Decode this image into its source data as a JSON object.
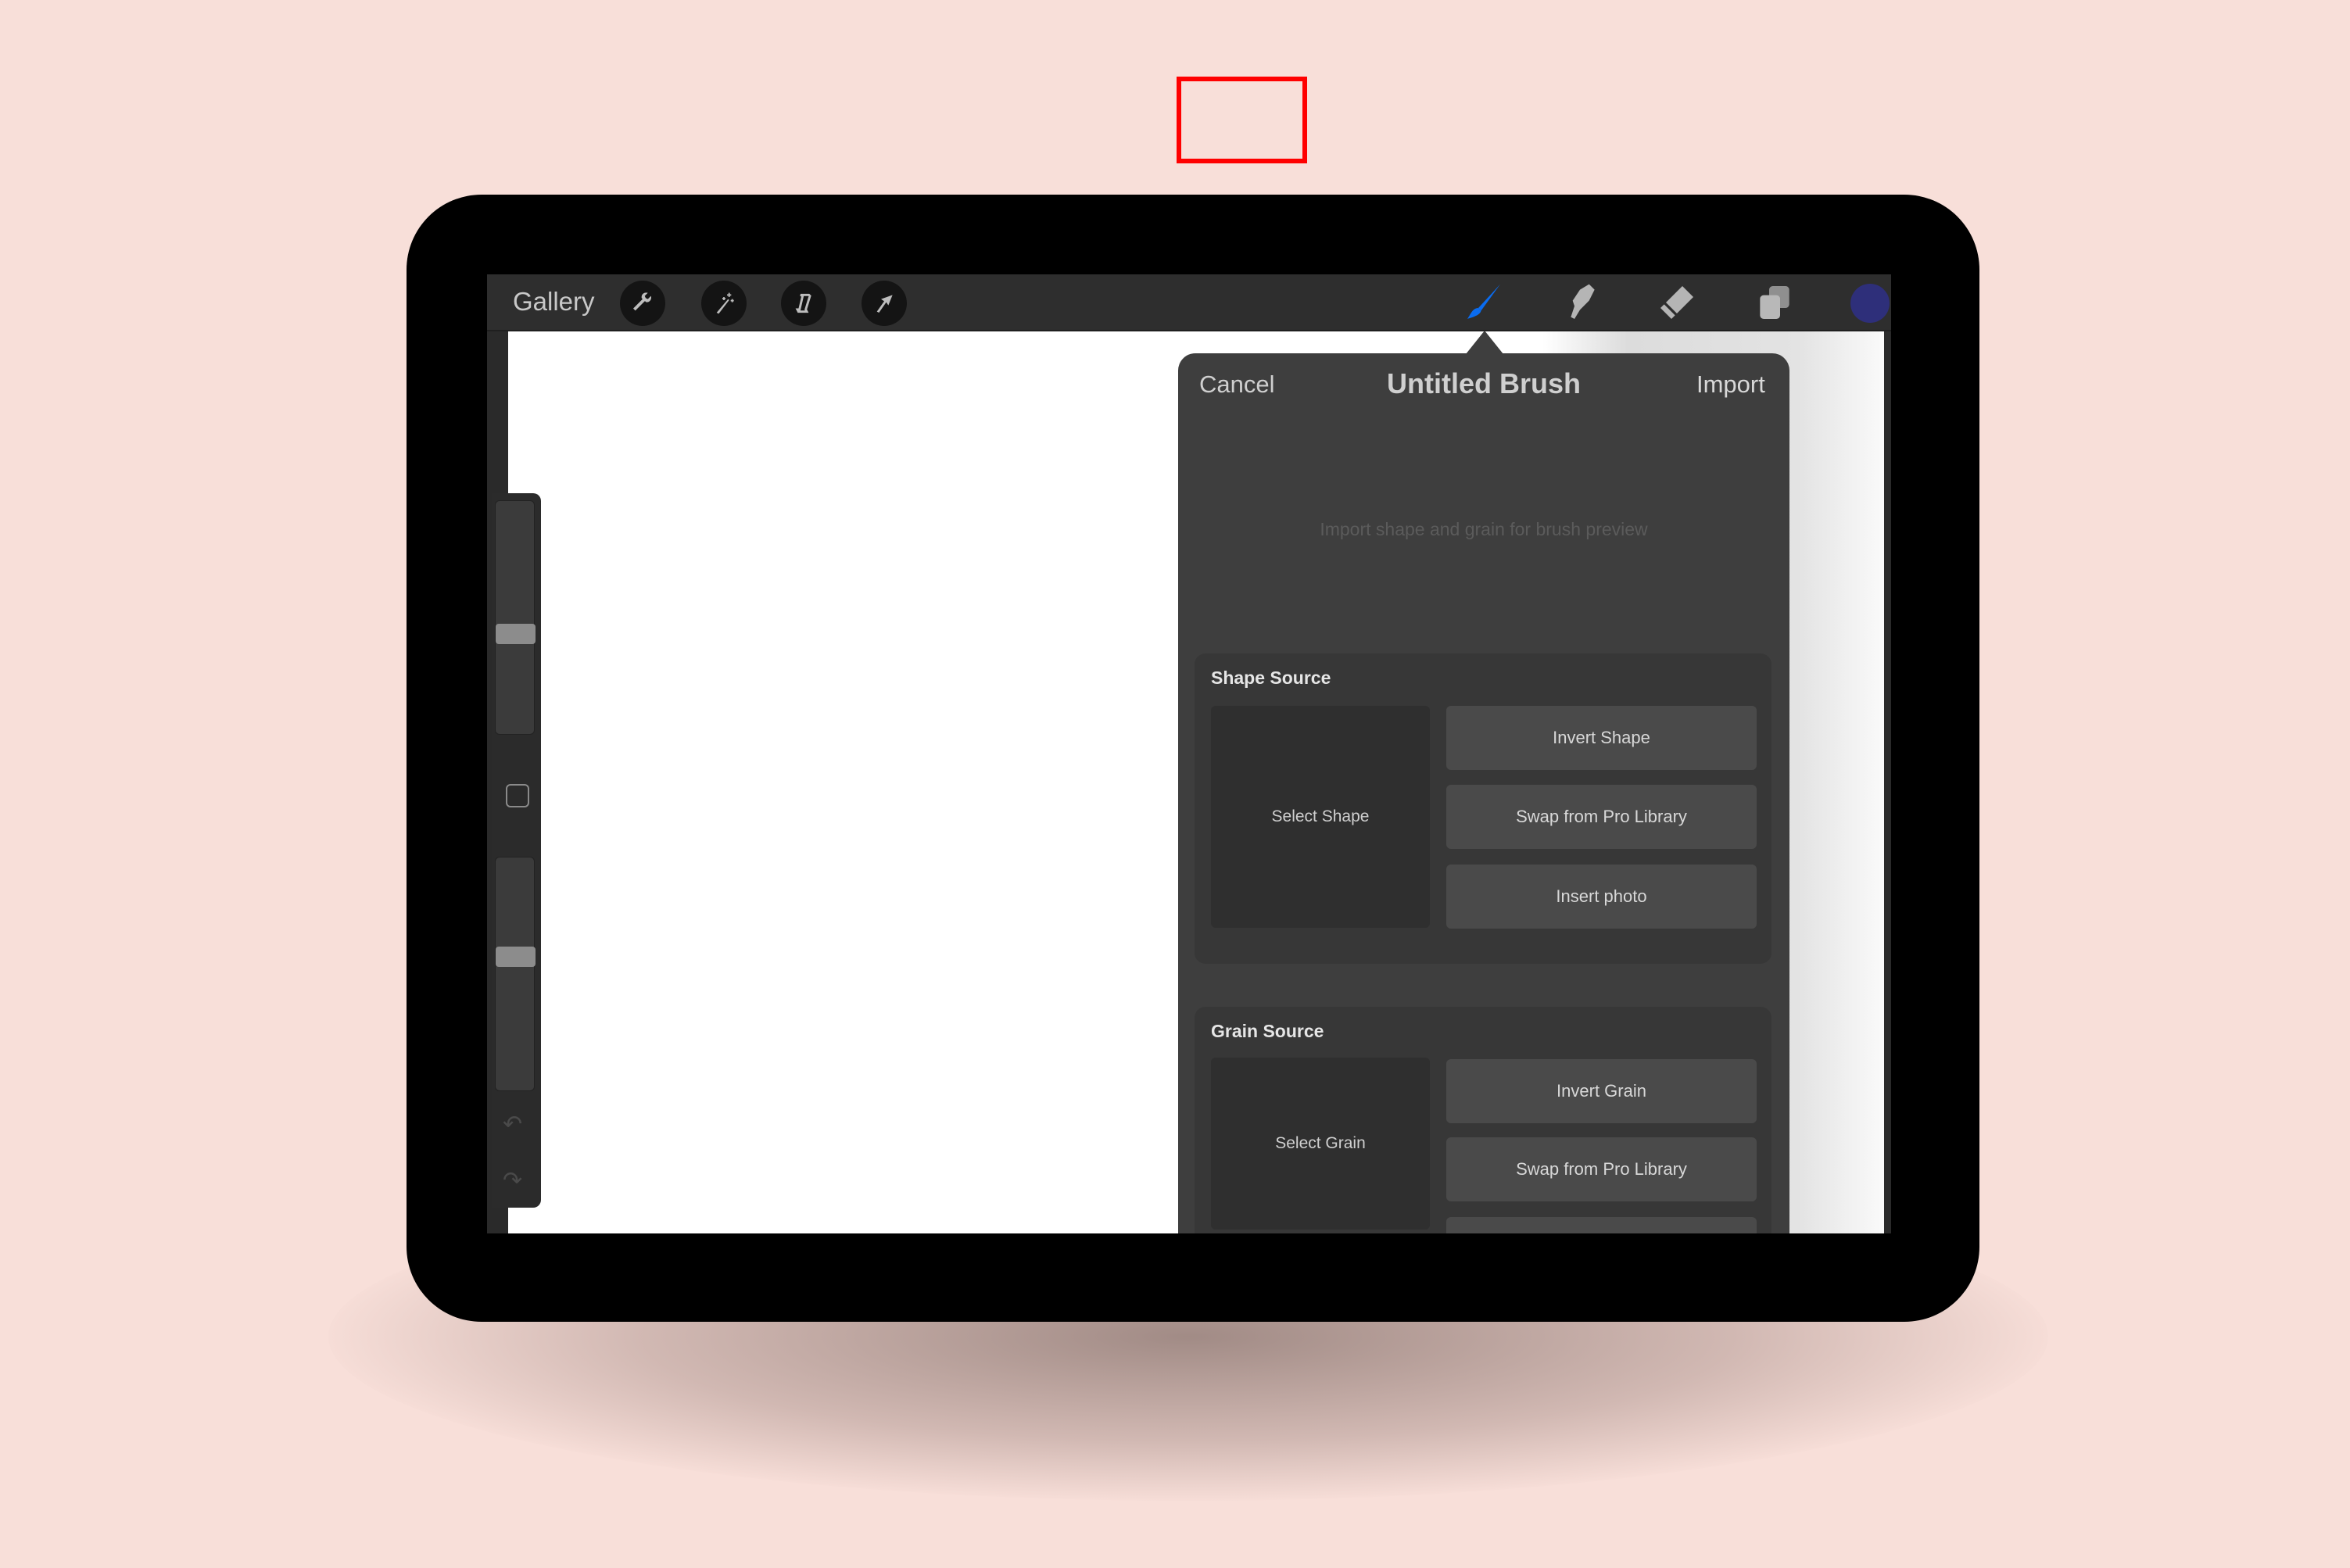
{
  "toolbar": {
    "gallery_label": "Gallery",
    "left_tools": [
      "wrench-icon",
      "magic-wand-icon",
      "selection-icon",
      "transform-arrow-icon"
    ],
    "right_tools": [
      "brush-icon",
      "smudge-icon",
      "eraser-icon",
      "layers-icon"
    ],
    "active_tool": "brush",
    "active_color": "#2e2f7a",
    "accent": "#0a6cf0"
  },
  "panel": {
    "cancel_label": "Cancel",
    "title": "Untitled Brush",
    "import_label": "Import",
    "preview_hint": "Import shape and grain for brush preview",
    "shape_source": {
      "header": "Shape Source",
      "select_label": "Select Shape",
      "buttons": [
        "Invert Shape",
        "Swap from Pro Library",
        "Insert photo"
      ]
    },
    "grain_source": {
      "header": "Grain Source",
      "select_label": "Select Grain",
      "buttons": [
        "Invert Grain",
        "Swap from Pro Library"
      ]
    }
  },
  "highlight": {
    "target": "Import",
    "color": "#ff0000"
  }
}
